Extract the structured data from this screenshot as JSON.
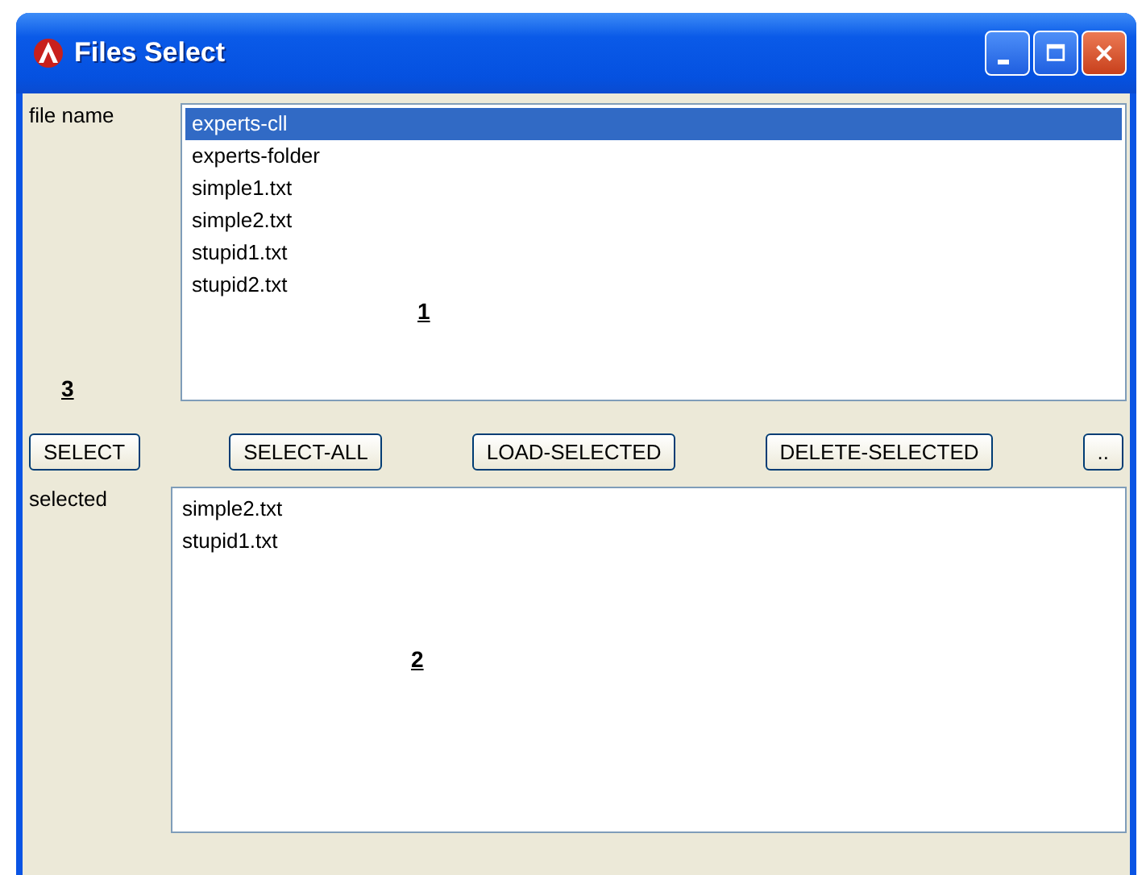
{
  "window": {
    "title": "Files Select"
  },
  "file_list": {
    "label": "file name",
    "items": [
      {
        "name": "experts-cll",
        "selected": true
      },
      {
        "name": "experts-folder",
        "selected": false
      },
      {
        "name": "simple1.txt",
        "selected": false
      },
      {
        "name": "simple2.txt",
        "selected": false
      },
      {
        "name": "stupid1.txt",
        "selected": false
      },
      {
        "name": "stupid2.txt",
        "selected": false
      }
    ],
    "marker": "1"
  },
  "side_marker": "3",
  "buttons": [
    "SELECT",
    "SELECT-ALL",
    "LOAD-SELECTED",
    "DELETE-SELECTED",
    ".."
  ],
  "selected_list": {
    "label": "selected",
    "items": [
      "simple2.txt",
      "stupid1.txt"
    ],
    "marker": "2"
  }
}
